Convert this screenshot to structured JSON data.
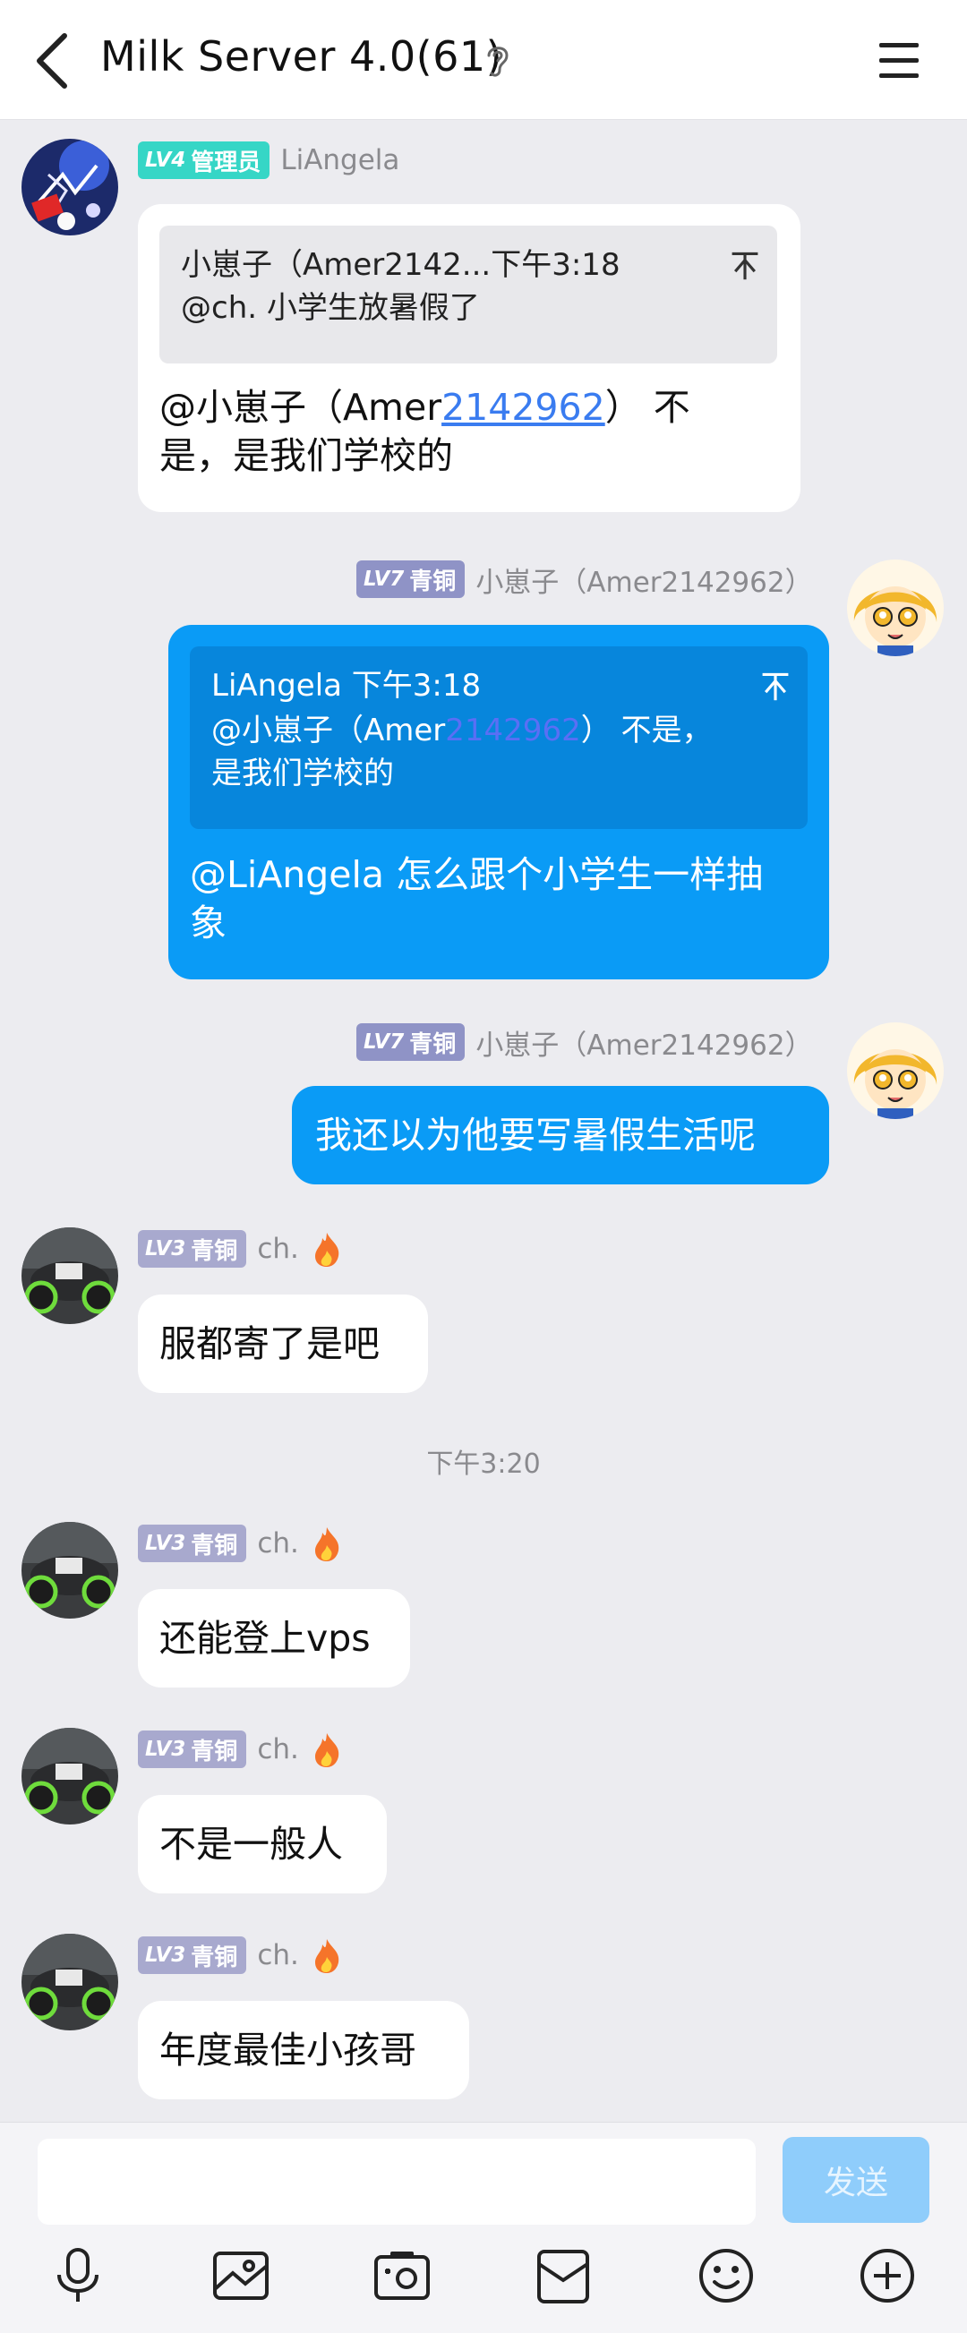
{
  "header": {
    "title": "Milk Server 4.0(61)"
  },
  "messages": [
    {
      "side": "in",
      "badge_level": "LV4",
      "badge_role": "管理员",
      "sender": "LiAngela",
      "quote": {
        "sender_time": "小崽子（Amer2142...下午3:18",
        "text": "@ch. 小学生放暑假了"
      },
      "text_line1_a": "@小崽子（Amer",
      "text_line1_link": "2142962",
      "text_line1_b": "）  不",
      "text_line2": "是，是我们学校的"
    },
    {
      "side": "out",
      "badge_level": "LV7",
      "badge_role": "青铜",
      "sender": "小崽子（Amer2142962）",
      "quote": {
        "sender_time": "LiAngela 下午3:18",
        "text_a": "@小崽子（Amer",
        "text_link": "2142962",
        "text_b": "）  不是，",
        "text_line2": "是我们学校的"
      },
      "text_line1": "@LiAngela 怎么跟个小学生一样抽",
      "text_line2": "象"
    },
    {
      "side": "out",
      "badge_level": "LV7",
      "badge_role": "青铜",
      "sender": "小崽子（Amer2142962）",
      "text": "我还以为他要写暑假生活呢"
    },
    {
      "side": "in",
      "badge_level": "LV3",
      "badge_role": "青铜",
      "sender": "ch.",
      "text": "服都寄了是吧"
    },
    {
      "side": "in",
      "badge_level": "LV3",
      "badge_role": "青铜",
      "sender": "ch.",
      "text": "还能登上vps"
    },
    {
      "side": "in",
      "badge_level": "LV3",
      "badge_role": "青铜",
      "sender": "ch.",
      "text": "不是一般人"
    },
    {
      "side": "in",
      "badge_level": "LV3",
      "badge_role": "青铜",
      "sender": "ch.",
      "text": "年度最佳小孩哥"
    }
  ],
  "timestamp": "下午3:20",
  "input": {
    "value": "",
    "send_label": "发送"
  },
  "toolbar": [
    "microphone-icon",
    "image-icon",
    "camera-icon",
    "file-icon",
    "emoji-icon",
    "plus-icon"
  ],
  "colors": {
    "outgoing_bubble": "#0a9bf6",
    "admin_badge": "#36d6c6",
    "bronze_badge": "#a8a9ce",
    "send_button": "#8fcdfb"
  }
}
